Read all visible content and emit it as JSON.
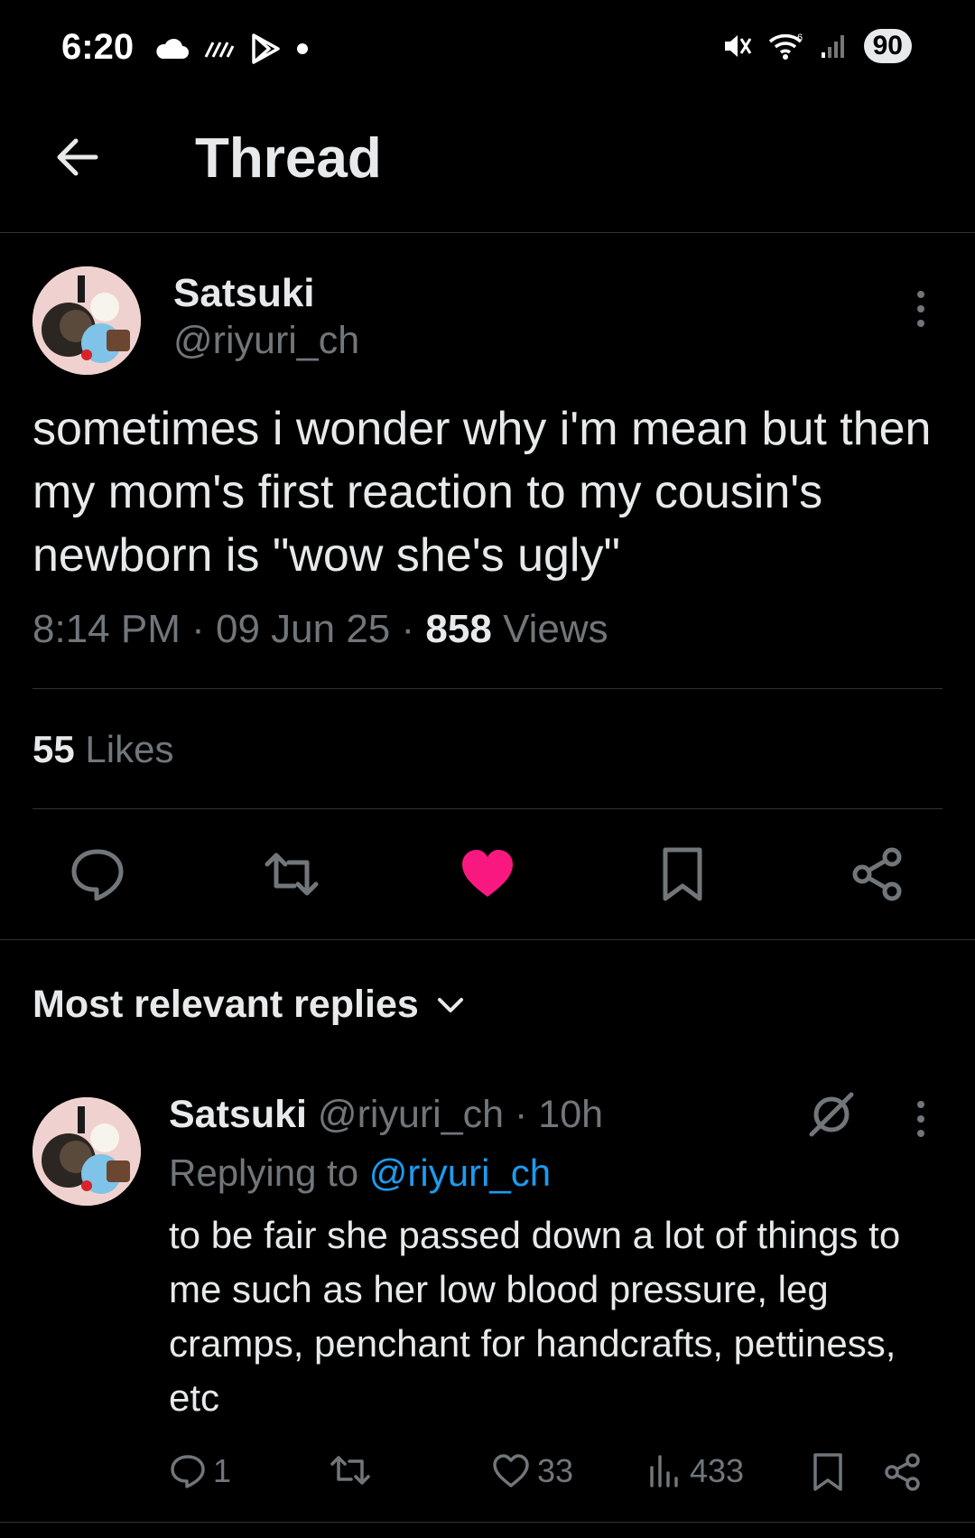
{
  "status_bar": {
    "time": "6:20",
    "battery": "90",
    "icons": [
      "cloud-icon",
      "data-saver-icon",
      "play-store-icon",
      "dot-icon",
      "mute-icon",
      "wifi-icon",
      "signal-icon"
    ]
  },
  "header": {
    "title": "Thread",
    "back_icon": "arrow-left-icon"
  },
  "tweet": {
    "author_name": "Satsuki",
    "author_handle": "@riyuri_ch",
    "text": "sometimes i wonder why i'm mean but then my mom's first reaction to my cousin's newborn is \"wow she's ugly\"",
    "time": "8:14 PM",
    "date": "09 Jun 25",
    "views_count": "858",
    "views_label": "Views",
    "likes_count": "55",
    "likes_label": "Likes",
    "liked": true,
    "like_color": "#f91880"
  },
  "replies": {
    "sort_label": "Most relevant replies",
    "items": [
      {
        "author_name": "Satsuki",
        "author_handle": "@riyuri_ch",
        "age": "10h",
        "replying_prefix": "Replying to",
        "replying_handle": "@riyuri_ch",
        "text": "to be fair she passed down a lot of things to me such as her low blood pressure, leg cramps, penchant for handcrafts, pettiness, etc",
        "reply_count": "1",
        "like_count": "33",
        "view_count": "433"
      }
    ]
  },
  "colors": {
    "background": "#000000",
    "text": "#e7e9ea",
    "muted": "#71767b",
    "link": "#1d9bf0",
    "like": "#f91880"
  }
}
